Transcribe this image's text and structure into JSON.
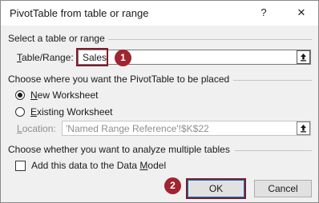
{
  "dialog": {
    "title": "PivotTable from table or range",
    "help_glyph": "?",
    "close_glyph": "✕"
  },
  "section_table": {
    "heading": "Select a table or range",
    "label_first": "T",
    "label_rest": "able/Range:",
    "value": "Sales"
  },
  "section_place": {
    "heading": "Choose where you want the PivotTable to be placed",
    "option_new_first": "N",
    "option_new_rest": "ew Worksheet",
    "option_existing_first": "E",
    "option_existing_rest": "xisting Worksheet",
    "selected": "new-worksheet",
    "location_first": "L",
    "location_rest": "ocation:",
    "location_value": "'Named Range Reference'!$K$22"
  },
  "section_multi": {
    "heading": "Choose whether you want to analyze multiple tables",
    "checkbox_first": "Add this data to the Data ",
    "checkbox_underlined": "M",
    "checkbox_rest": "odel",
    "checked": false
  },
  "buttons": {
    "ok": "OK",
    "cancel": "Cancel"
  },
  "markers": {
    "step1": "1",
    "step2": "2"
  },
  "colors": {
    "marker": "#9f2530",
    "highlight_border": "#7f1b27",
    "default_button_border": "#0078d7"
  },
  "icons": {
    "collapse_button": "collapse-dialog-arrow-icon"
  }
}
